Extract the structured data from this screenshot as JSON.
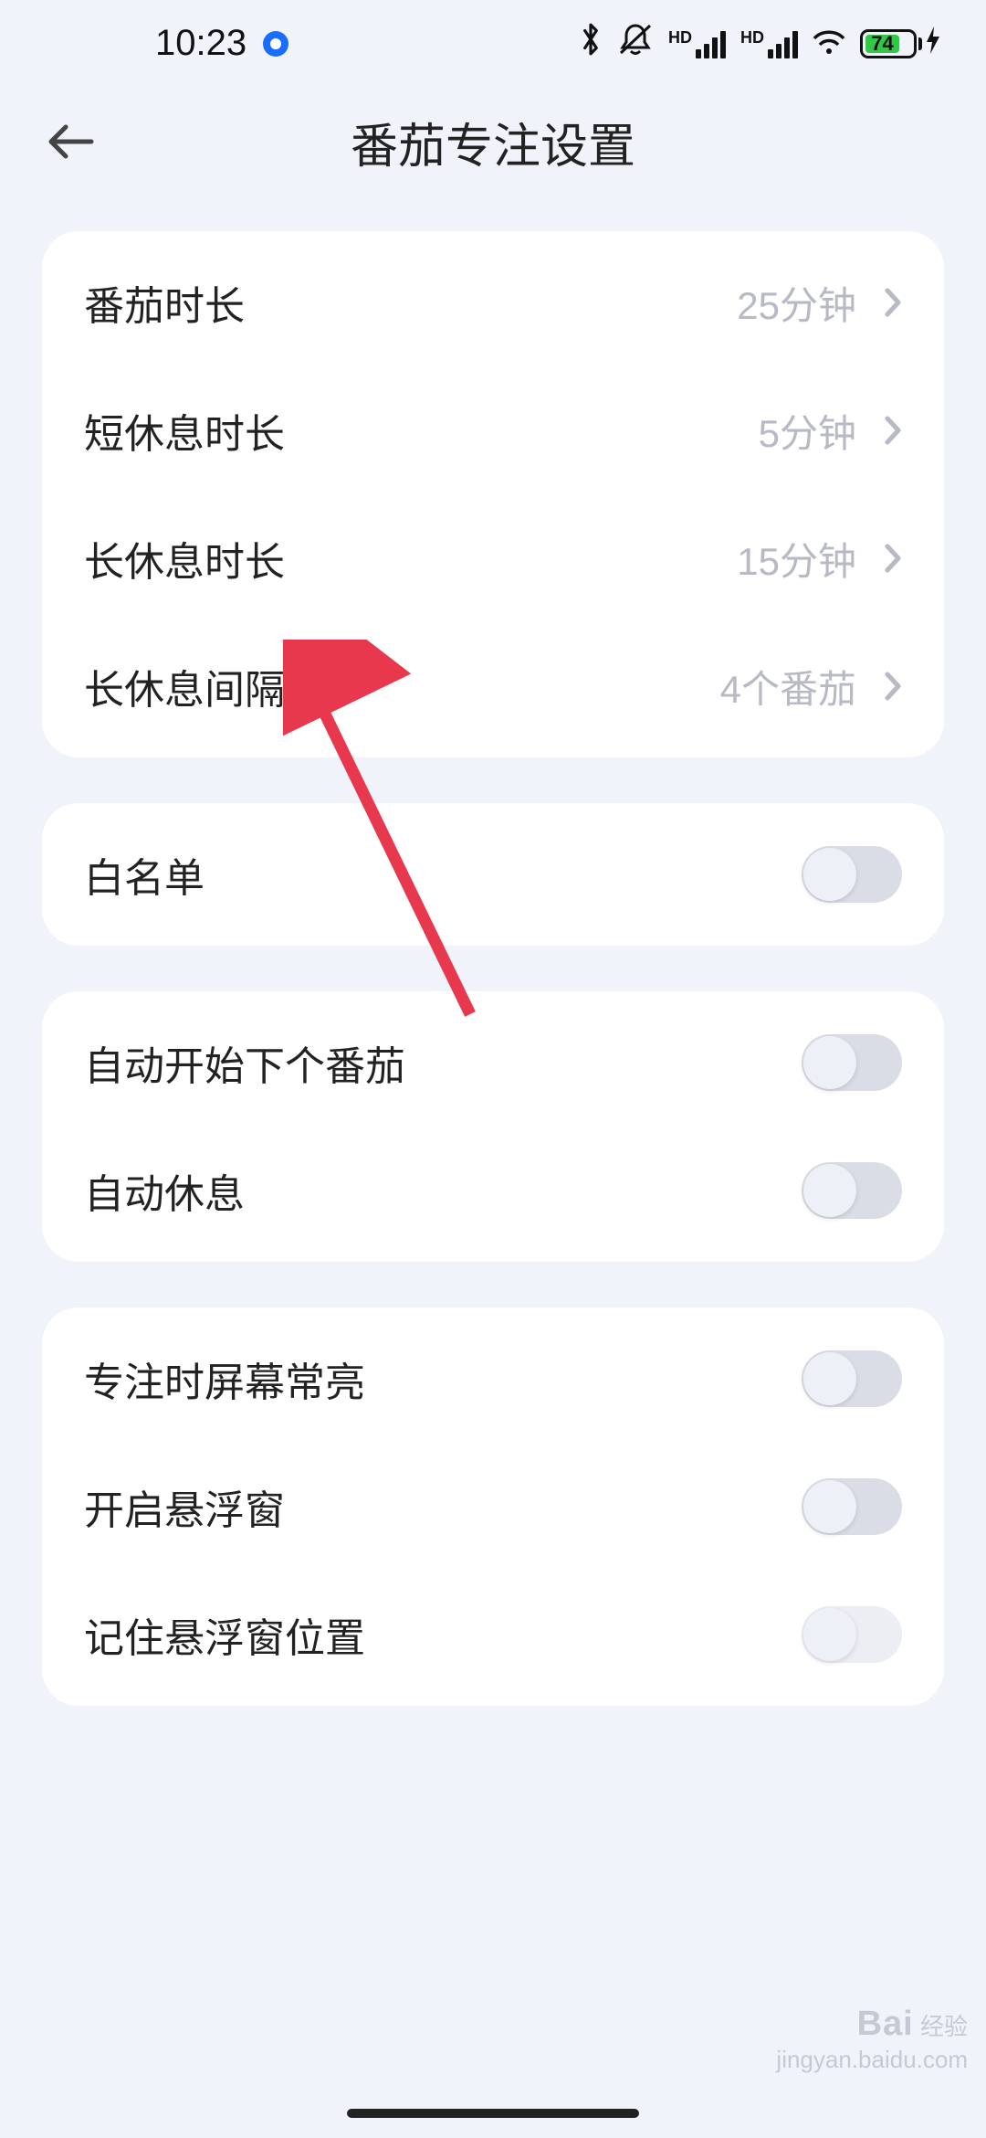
{
  "status": {
    "time": "10:23",
    "battery_pct": "74"
  },
  "header": {
    "title": "番茄专注设置"
  },
  "group1": {
    "pomo_len_label": "番茄时长",
    "pomo_len_value": "25分钟",
    "short_break_label": "短休息时长",
    "short_break_value": "5分钟",
    "long_break_label": "长休息时长",
    "long_break_value": "15分钟",
    "long_break_interval_label": "长休息间隔",
    "long_break_interval_value": "4个番茄"
  },
  "group2": {
    "whitelist_label": "白名单"
  },
  "group3": {
    "auto_next_label": "自动开始下个番茄",
    "auto_rest_label": "自动休息"
  },
  "group4": {
    "screen_on_label": "专注时屏幕常亮",
    "floating_label": "开启悬浮窗",
    "remember_float_label": "记住悬浮窗位置"
  },
  "watermark": {
    "brand": "Bai",
    "brand2": "经验",
    "url": "jingyan.baidu.com"
  }
}
